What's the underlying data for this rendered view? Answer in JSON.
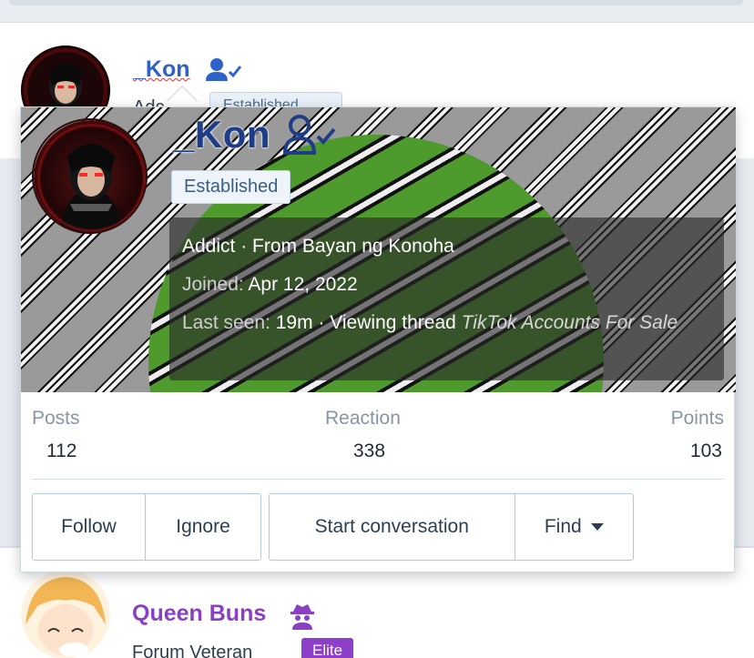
{
  "background_posts": [
    {
      "username": "_Kon",
      "title_partial": "Adc",
      "badge": "Established",
      "name_color": "#2f62c9"
    },
    {
      "username": "Queen Buns",
      "title": "Forum Veteran",
      "badge": "Elite",
      "name_color": "#8a3fc4"
    }
  ],
  "member_tooltip": {
    "username": "_Kon",
    "username_icon": "user-check-icon",
    "badge": "Established",
    "title_line": "Addict · From Bayan ng Konoha",
    "joined_label": "Joined:",
    "joined_value": "Apr 12, 2022",
    "last_seen_label": "Last seen:",
    "last_seen_value": "19m · Viewing thread",
    "last_seen_thread": "TikTok Accounts For Sale",
    "stats": [
      {
        "label": "Posts",
        "value": "112"
      },
      {
        "label": "Reaction",
        "value": "338"
      },
      {
        "label": "Points",
        "value": "103"
      }
    ],
    "buttons": {
      "follow": "Follow",
      "ignore": "Ignore",
      "start_conversation": "Start conversation",
      "find": "Find"
    }
  },
  "colors": {
    "kon_name": "#1f3c88",
    "queen_name": "#8a3fc4",
    "elite_badge": "#8d3fc9",
    "banner_green": "#4e9a2c"
  }
}
